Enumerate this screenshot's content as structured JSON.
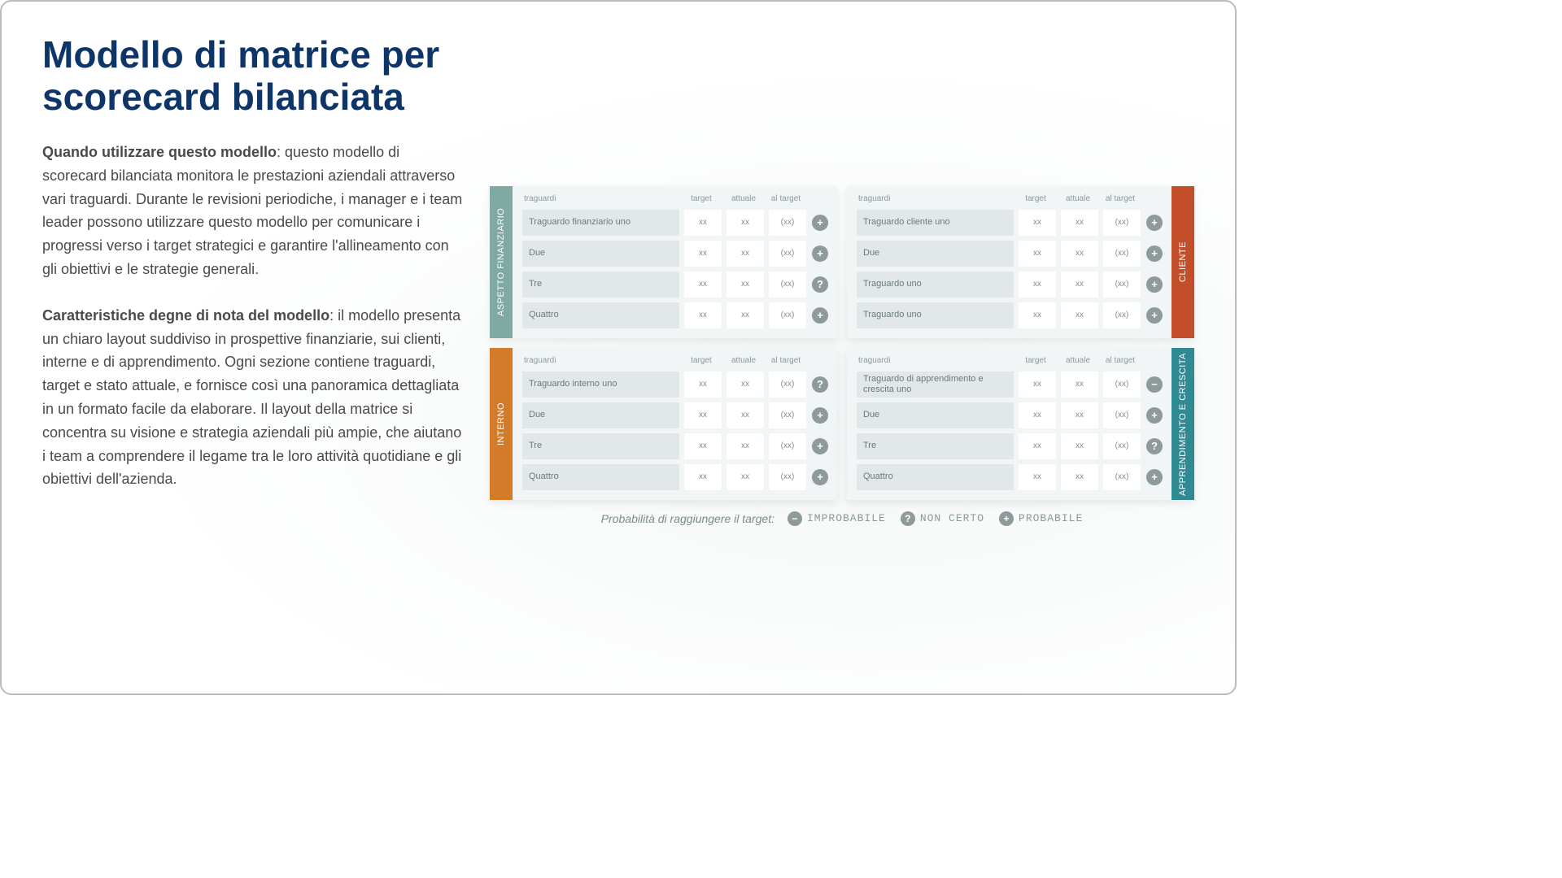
{
  "title": "Modello di matrice per scorecard bilanciata",
  "para1_bold": "Quando utilizzare questo modello",
  "para1": ": questo modello di scorecard bilanciata monitora le prestazioni aziendali attraverso vari traguardi. Durante le revisioni periodiche, i manager e i team leader possono utilizzare questo modello per comunicare i progressi verso i target strategici e garantire l'allineamento con gli obiettivi e le strategie generali.",
  "para2_bold": "Caratteristiche degne di nota del modello",
  "para2": ": il modello presenta un chiaro layout suddiviso in prospettive finanziarie, sui clienti, interne e di apprendimento. Ogni sezione contiene traguardi, target e stato attuale, e fornisce così una panoramica dettagliata in un formato facile da elaborare. Il layout della matrice si concentra su visione e strategia aziendali più ampie, che aiutano i team a comprendere il legame tra le loro attività quotidiane e gli obiettivi dell'azienda.",
  "headers": {
    "c0": "traguardi",
    "c1": "target",
    "c2": "attuale",
    "c3": "al target"
  },
  "val": {
    "x": "xx",
    "p": "(xx)"
  },
  "quadrants": [
    {
      "tab": "ASPETTO FINANZIARIO",
      "tabSide": "left",
      "tabColor": "teal",
      "rows": [
        {
          "label": "Traguardo finanziario uno",
          "status": "plus"
        },
        {
          "label": "Due",
          "status": "plus"
        },
        {
          "label": "Tre",
          "status": "q"
        },
        {
          "label": "Quattro",
          "status": "plus"
        }
      ]
    },
    {
      "tab": "CLIENTE",
      "tabSide": "right",
      "tabColor": "red",
      "rows": [
        {
          "label": "Traguardo cliente uno",
          "status": "plus"
        },
        {
          "label": "Due",
          "status": "plus"
        },
        {
          "label": "Traguardo uno",
          "status": "plus"
        },
        {
          "label": "Traguardo uno",
          "status": "plus"
        }
      ]
    },
    {
      "tab": "INTERNO",
      "tabSide": "left",
      "tabColor": "orange",
      "rows": [
        {
          "label": "Traguardo interno uno",
          "status": "q"
        },
        {
          "label": "Due",
          "status": "plus"
        },
        {
          "label": "Tre",
          "status": "plus"
        },
        {
          "label": "Quattro",
          "status": "plus"
        }
      ]
    },
    {
      "tab": "APPRENDIMENTO E CRESCITA",
      "tabSide": "right",
      "tabColor": "teal2",
      "rows": [
        {
          "label": "Traguardo di apprendimento e crescita uno",
          "status": "minus"
        },
        {
          "label": "Due",
          "status": "plus"
        },
        {
          "label": "Tre",
          "status": "q"
        },
        {
          "label": "Quattro",
          "status": "plus"
        }
      ]
    }
  ],
  "legend": {
    "label": "Probabilità di raggiungere il target:",
    "items": [
      {
        "icon": "minus",
        "text": "IMPROBABILE"
      },
      {
        "icon": "q",
        "text": "NON CERTO"
      },
      {
        "icon": "plus",
        "text": "PROBABILE"
      }
    ]
  },
  "icons": {
    "plus": "+",
    "minus": "−",
    "q": "?"
  }
}
